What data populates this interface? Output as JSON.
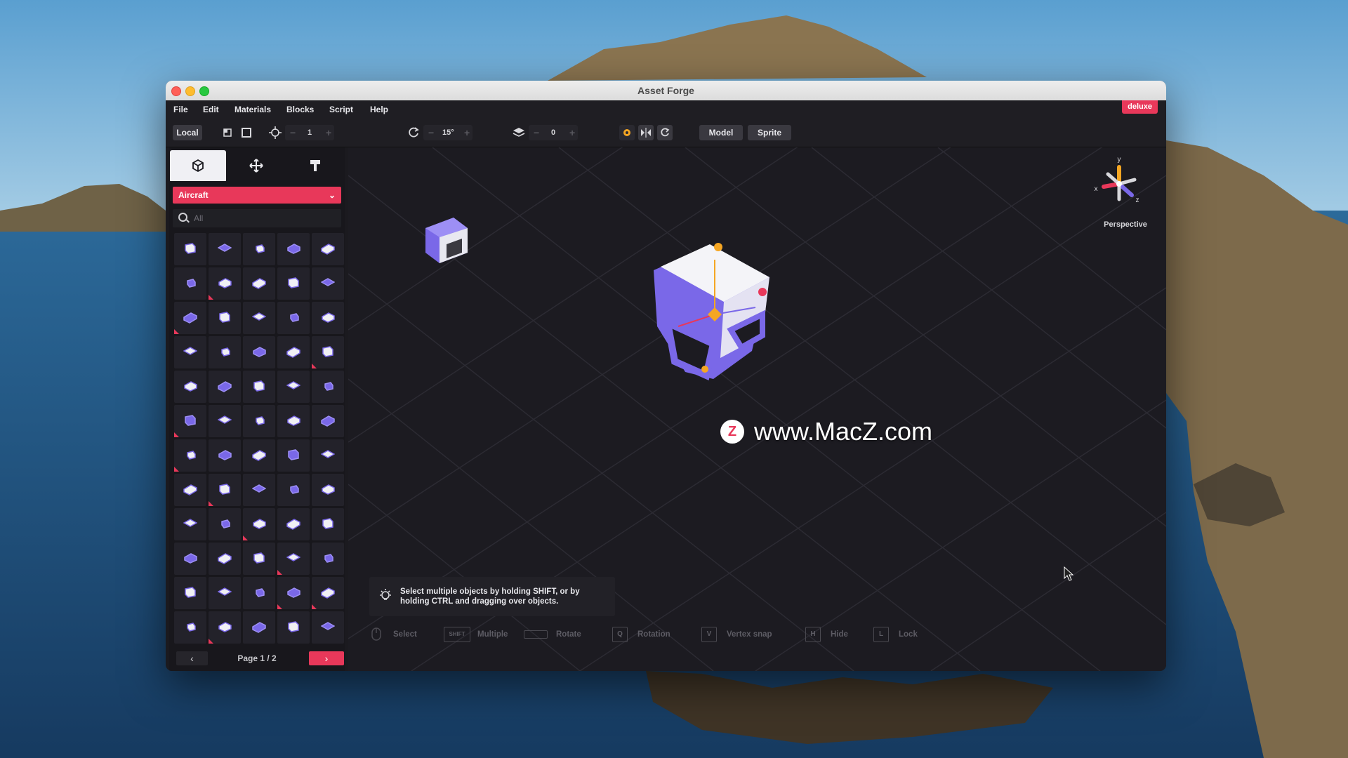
{
  "window": {
    "title": "Asset Forge"
  },
  "menu": {
    "items": [
      "File",
      "Edit",
      "Materials",
      "Blocks",
      "Script",
      "Help"
    ],
    "badge": "deluxe"
  },
  "toolbar": {
    "local_label": "Local",
    "move_step": "1",
    "rotate_step": "15°",
    "layer": "0",
    "model_label": "Model",
    "sprite_label": "Sprite"
  },
  "sidebar": {
    "category": "Aircraft",
    "search_placeholder": "All",
    "page_label": "Page 1 / 2",
    "prev_glyph": "‹",
    "next_glyph": "›"
  },
  "viewport": {
    "view_mode": "Perspective",
    "axis_labels": {
      "x": "x",
      "y": "y",
      "z": "z"
    },
    "hint": "Select multiple objects by holding SHIFT, or by holding CTRL and dragging over objects.",
    "shortcuts": [
      {
        "key": "",
        "label": "Select"
      },
      {
        "key": "SHIFT",
        "label": "Multiple"
      },
      {
        "key": "",
        "label": "Rotate"
      },
      {
        "key": "Q",
        "label": "Rotation"
      },
      {
        "key": "V",
        "label": "Vertex snap"
      },
      {
        "key": "H",
        "label": "Hide"
      },
      {
        "key": "L",
        "label": "Lock"
      }
    ]
  },
  "watermark": "www.MacZ.com",
  "colors": {
    "accent": "#e8385a",
    "block_purple": "#7a68e8",
    "gizmo_orange": "#f5a623"
  }
}
